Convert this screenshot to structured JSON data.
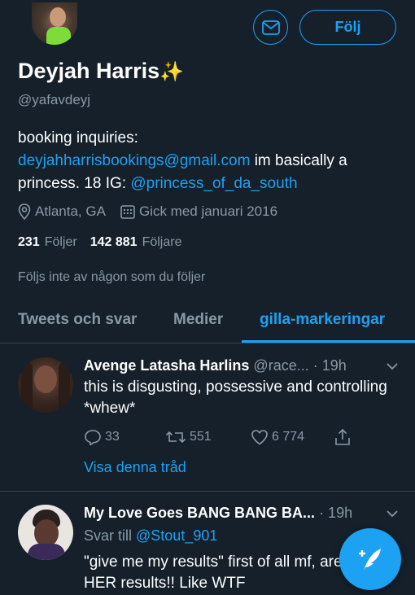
{
  "profile": {
    "name": "Deyjah Harris",
    "name_emoji": "✨",
    "handle": "@yafavdeyj",
    "bio_line1": "booking inquiries:",
    "bio_email": "deyjahharrisbookings@gmail.com",
    "bio_mid1": " im basically a",
    "bio_mid2": "princess. 18 IG: ",
    "bio_ig": "@princess_of_da_south",
    "location": "Atlanta, GA",
    "joined": "Gick med januari 2016",
    "following_count": "231",
    "following_label": "Följer",
    "followers_count": "142 881",
    "followers_label": "Följare",
    "followed_by": "Följs inte av någon som du följer"
  },
  "buttons": {
    "follow_label": "Följ"
  },
  "tabs": [
    {
      "label": "Tweets och svar"
    },
    {
      "label": "Medier"
    },
    {
      "label": "gilla-markeringar"
    }
  ],
  "tweets": [
    {
      "author": "Avenge Latasha Harlins",
      "handle": "@race...",
      "time": "· 19h",
      "text": "this is disgusting, possessive and controlling *whew*",
      "replies": "33",
      "retweets": "551",
      "likes": "6 774",
      "show_thread": "Visa denna tråd"
    },
    {
      "author": "My Love Goes BANG BANG BA...",
      "time": "· 19h",
      "reply_prefix": "Svar till ",
      "reply_to": "@Stout_901",
      "text": "\"give me my results\" first of all mf, are HER results!! Like WTF"
    }
  ],
  "colors": {
    "background": "#15202b",
    "accent": "#1da1f2",
    "secondary_text": "#8899a6",
    "divider": "#38444d"
  }
}
